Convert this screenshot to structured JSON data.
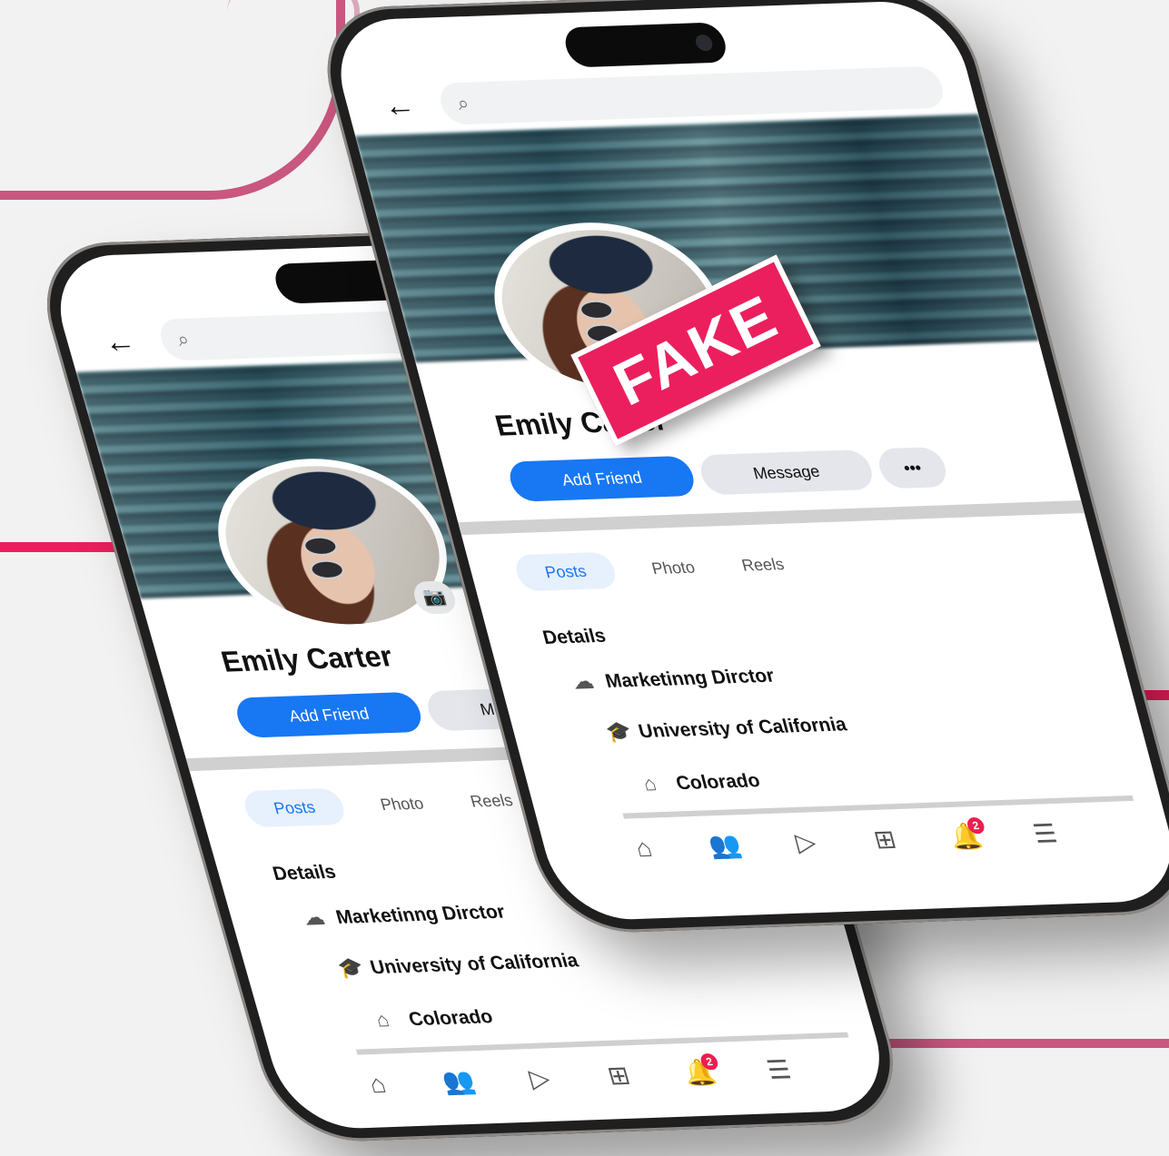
{
  "colors": {
    "accent": "#1877f2",
    "stamp": "#ec1f5e",
    "decor": "#c9577f"
  },
  "icons": {
    "back": "arrow-left-icon",
    "search": "search-icon",
    "camera": "camera-icon",
    "work": "briefcase-icon",
    "education": "graduation-cap-icon",
    "home": "house-icon",
    "nav": [
      "home-icon",
      "friends-icon",
      "video-icon",
      "marketplace-icon",
      "bell-icon",
      "menu-icon"
    ]
  },
  "stamp_label": "FAKE",
  "back_phone": {
    "profile_name": "Emily Carter",
    "add_friend_label": "Add Friend",
    "message_label": "Message",
    "tabs": [
      "Posts",
      "Photo",
      "Reels"
    ],
    "details_title": "Details",
    "details": [
      "Marketinng Dirctor",
      "University of California",
      "Colorado"
    ],
    "notification_count": "2"
  },
  "front_phone": {
    "profile_name": "Emily Carter",
    "add_friend_label": "Add Friend",
    "message_label": "Message",
    "more_label": "•••",
    "tabs": [
      "Posts",
      "Photo",
      "Reels"
    ],
    "details_title": "Details",
    "details": [
      "Marketinng Dirctor",
      "University of California",
      "Colorado"
    ],
    "notification_count": "2"
  }
}
